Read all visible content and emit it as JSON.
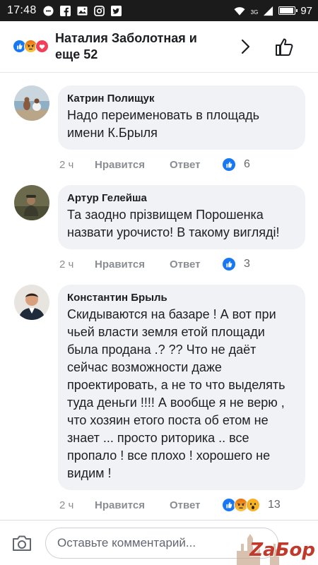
{
  "status_bar": {
    "time": "17:48",
    "signal_label": "3G",
    "battery": "97",
    "battery_level": 0.97
  },
  "header": {
    "title": "Наталия Заболотная и еще 52",
    "reaction_icons": [
      "like-icon",
      "angry-icon",
      "love-icon"
    ]
  },
  "comments": [
    {
      "author": "Катрин Полищук",
      "text": "Надо переименовать в площадь имени К.Брыля",
      "time": "2 ч",
      "like_label": "Нравится",
      "reply_label": "Ответ",
      "reactions": [
        "like-icon"
      ],
      "reaction_count": "6"
    },
    {
      "author": "Артур Гелейша",
      "text": "Та заодно прізвищем Порошенка назвати урочисто! В такому вигляді!",
      "time": "2 ч",
      "like_label": "Нравится",
      "reply_label": "Ответ",
      "reactions": [
        "like-icon"
      ],
      "reaction_count": "3"
    },
    {
      "author": "Константин Брыль",
      "text": "Скидываются на базаре ! А вот при чьей власти земля етой площади была продана .? ?? Что не даёт сейчас возможности даже проектировать, а не то что выделять туда деньги !!!! А вообще я не верю , что хозяин етого поста об етом не знает ... просто риторика .. все пропало ! все плохо ! хорошего не видим !",
      "time": "2 ч",
      "like_label": "Нравится",
      "reply_label": "Ответ",
      "reactions": [
        "like-icon",
        "angry-icon",
        "wow-icon"
      ],
      "reaction_count": "13"
    }
  ],
  "composer": {
    "placeholder": "Оставьте комментарий..."
  },
  "watermark": {
    "text": "ZaБор"
  },
  "colors": {
    "like": "#1877f2",
    "love": "#f33e58",
    "angry": "#e9710f",
    "wow": "#f7b125",
    "bubble": "#f0f2f5",
    "meta_text": "#8a8d91"
  }
}
